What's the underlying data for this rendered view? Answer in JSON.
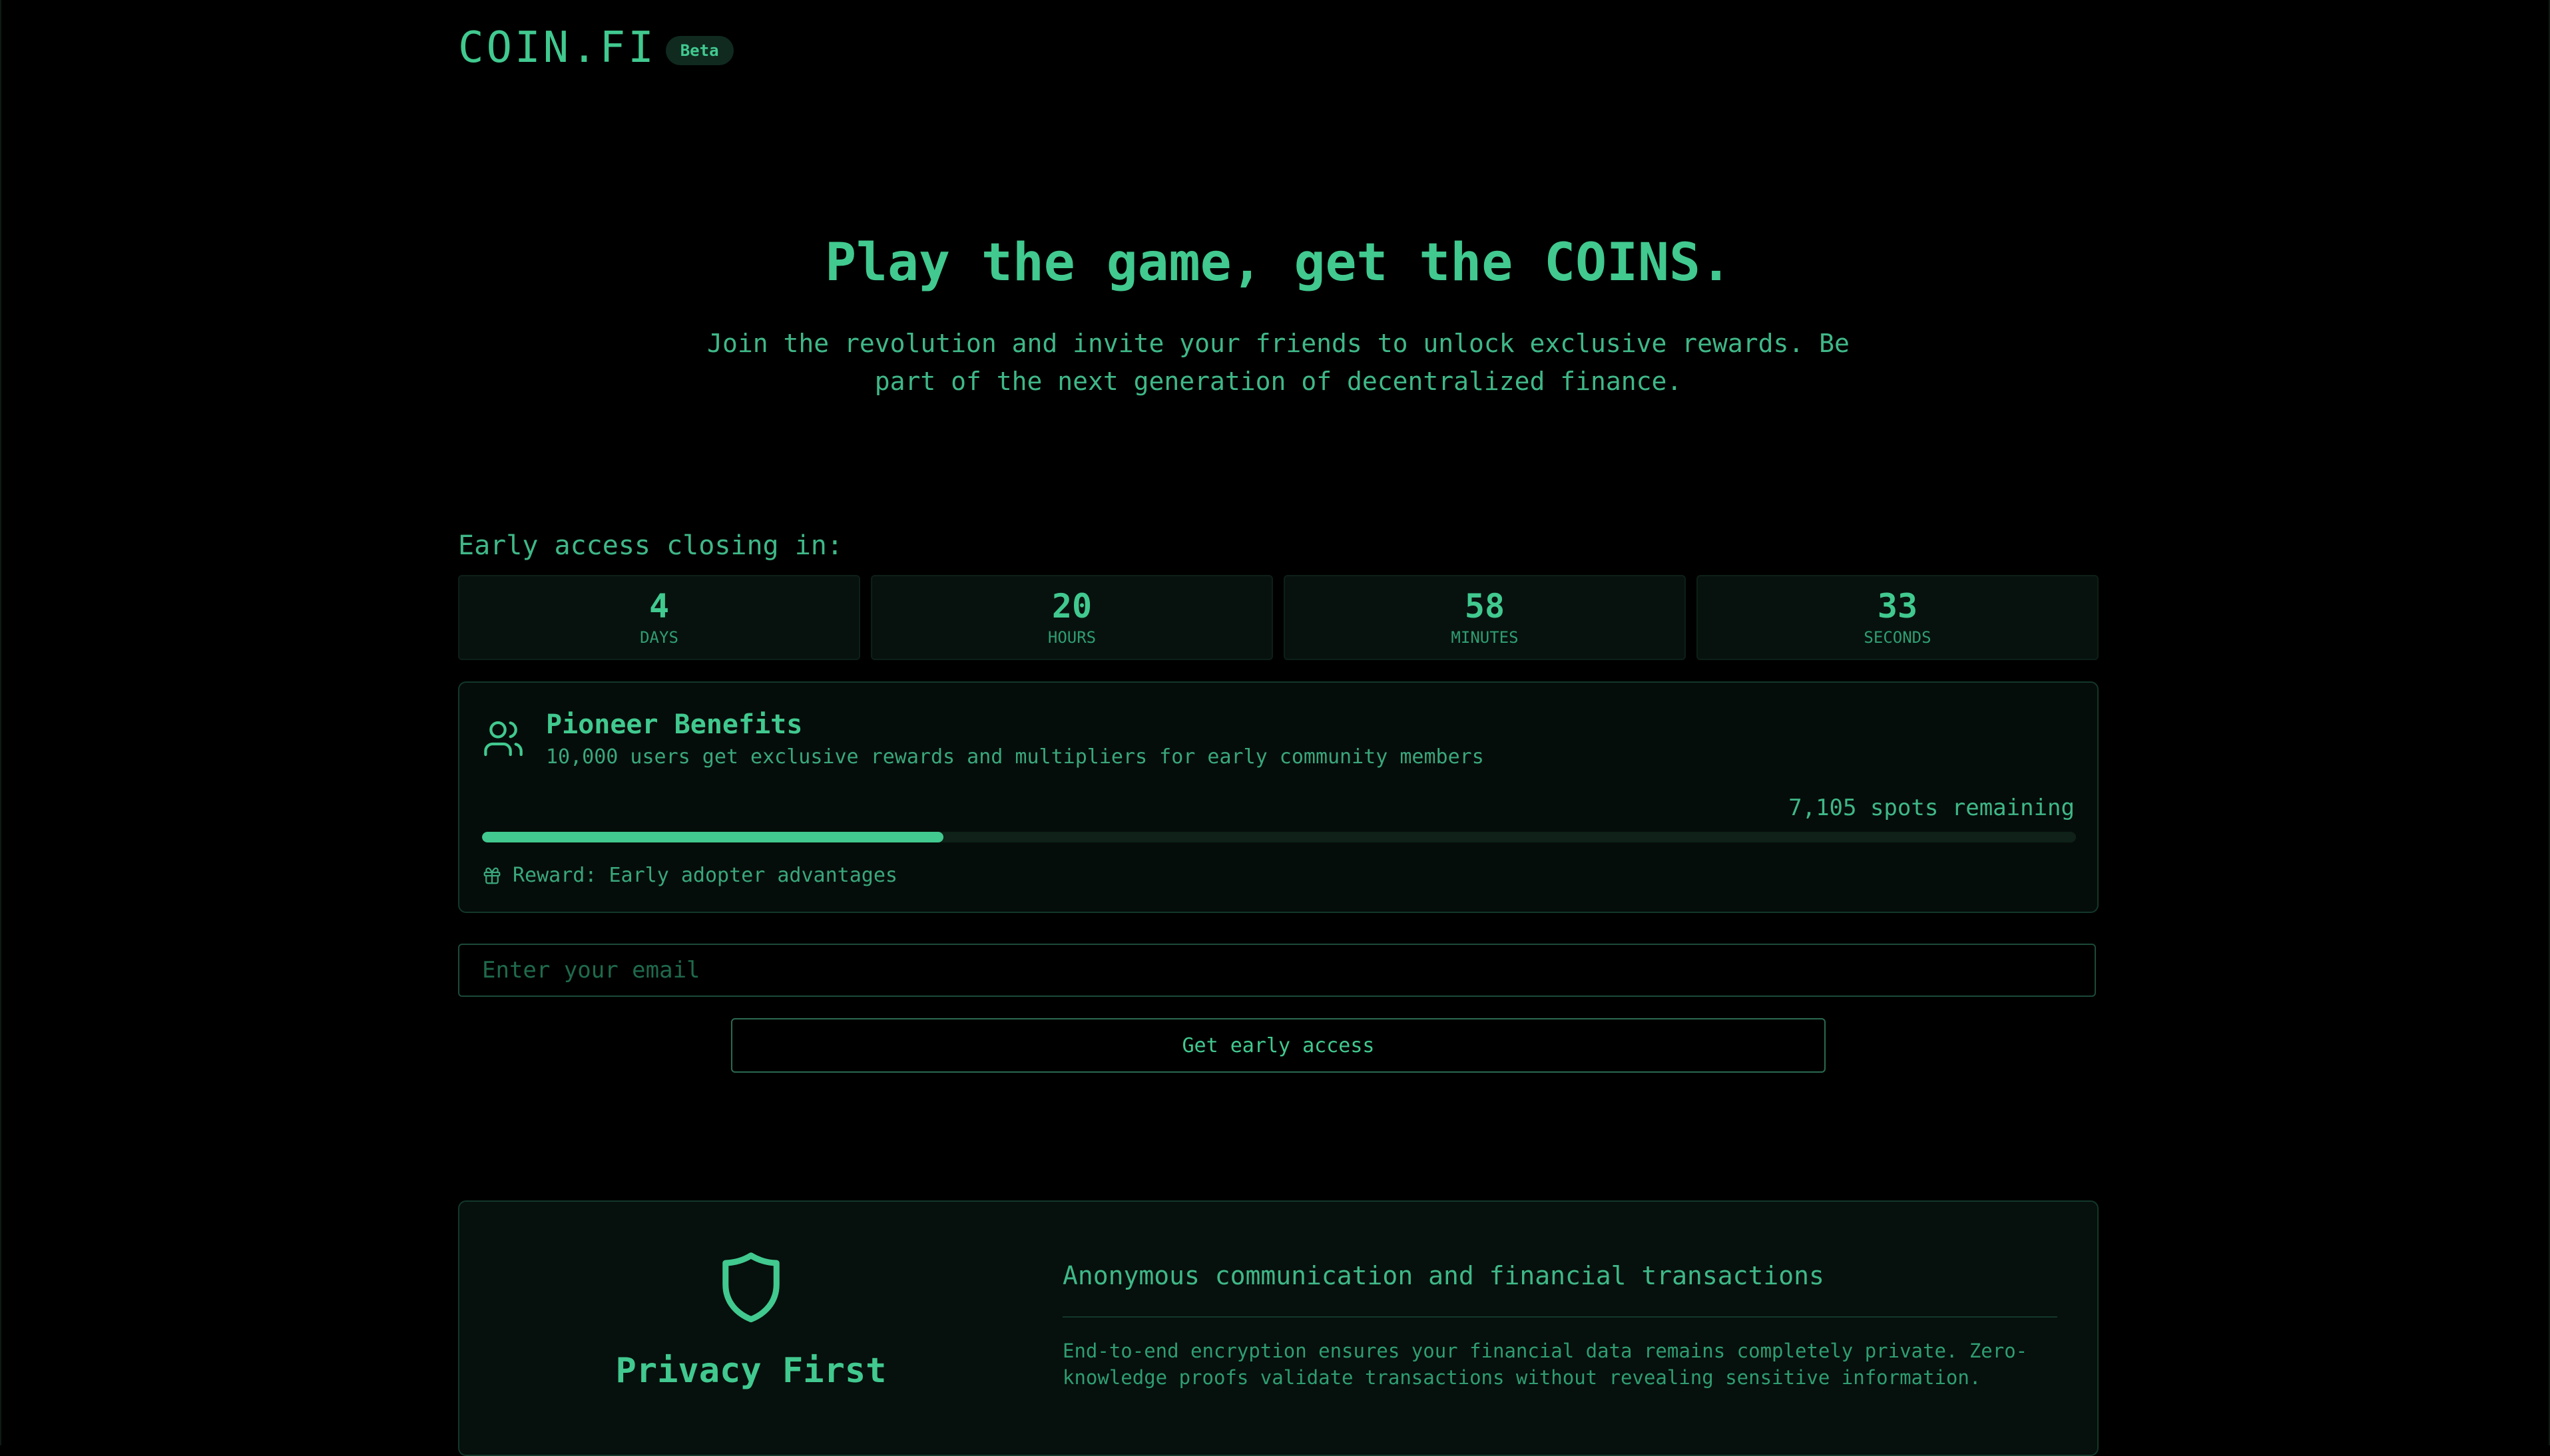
{
  "header": {
    "logo": "COIN.FI",
    "badge": "Beta"
  },
  "hero": {
    "title": "Play the game, get the COINS.",
    "subtitle": "Join the revolution and invite your friends to unlock exclusive rewards. Be part of the next generation of decentralized finance."
  },
  "countdown": {
    "label": "Early access closing in:",
    "units": [
      {
        "value": "4",
        "label": "DAYS"
      },
      {
        "value": "20",
        "label": "HOURS"
      },
      {
        "value": "58",
        "label": "MINUTES"
      },
      {
        "value": "33",
        "label": "SECONDS"
      }
    ]
  },
  "pioneer": {
    "icon": "users-icon",
    "title": "Pioneer Benefits",
    "description": "10,000 users get exclusive rewards and multipliers for early community members",
    "spots_remaining": "7,105 spots remaining",
    "progress_fraction": 0.2895,
    "reward_icon": "gift-icon",
    "reward": "Reward: Early adopter advantages"
  },
  "signup": {
    "email_placeholder": "Enter your email",
    "email_value": "",
    "button_label": "Get early access"
  },
  "privacy": {
    "icon": "shield-icon",
    "title": "Privacy First",
    "heading": "Anonymous communication and financial transactions",
    "body": "End-to-end encryption ensures your financial data remains completely private. Zero-knowledge proofs validate transactions without revealing sensitive information."
  },
  "colors": {
    "background": "#000000",
    "accent": "#41c98f",
    "card_border": "#12382a"
  }
}
